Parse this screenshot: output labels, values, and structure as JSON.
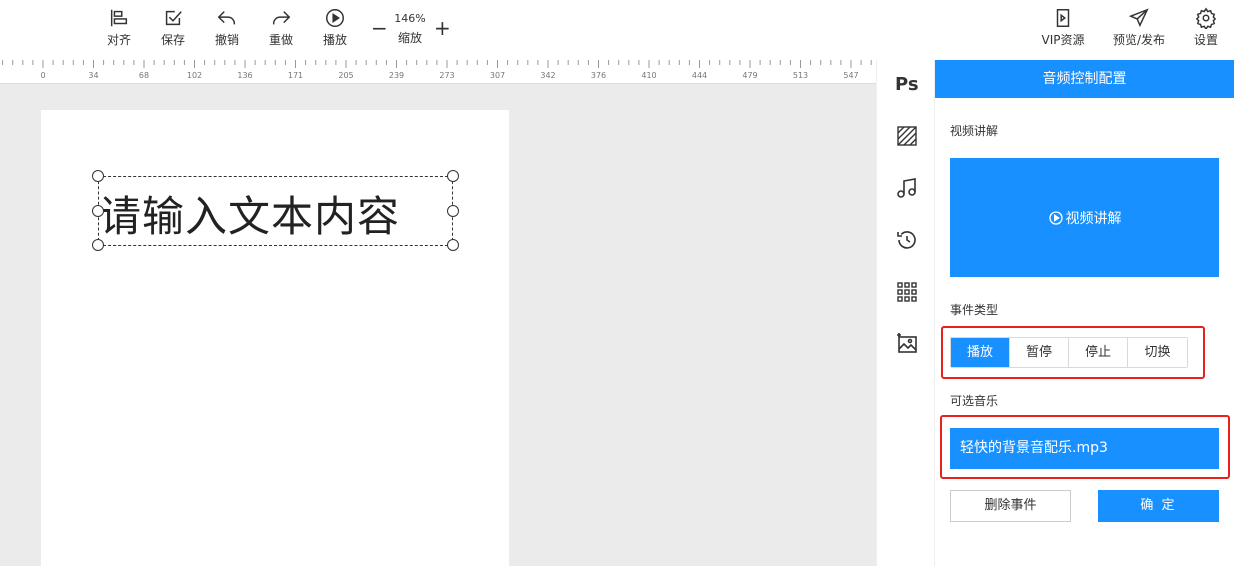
{
  "toolbar": {
    "align": "对齐",
    "save": "保存",
    "undo": "撤销",
    "redo": "重做",
    "play": "播放",
    "zoom_percent": "146%",
    "zoom_label": "缩放",
    "zoom_minus": "−",
    "zoom_plus": "+",
    "vip": "VIP资源",
    "preview_publish": "预览/发布",
    "settings": "设置"
  },
  "ruler": {
    "ticks": [
      "0",
      "34",
      "68",
      "102",
      "136",
      "171",
      "205",
      "239",
      "273",
      "307",
      "342",
      "376",
      "410",
      "444",
      "479",
      "513",
      "547"
    ]
  },
  "canvas": {
    "text_content": "请输入文本内容"
  },
  "side_icons": {
    "ps": "Ps"
  },
  "panel": {
    "title": "音频控制配置",
    "video_section_label": "视频讲解",
    "video_button": "视频讲解",
    "event_type_label": "事件类型",
    "event_types": [
      "播放",
      "暂停",
      "停止",
      "切换"
    ],
    "active_event": "播放",
    "music_label": "可选音乐",
    "music_item": "轻快的背景音配乐.mp3",
    "delete_button": "删除事件",
    "ok_button": "确 定"
  },
  "colors": {
    "accent": "#1890ff",
    "highlight_frame": "#e8211f",
    "canvas_bg": "#ebebeb"
  }
}
